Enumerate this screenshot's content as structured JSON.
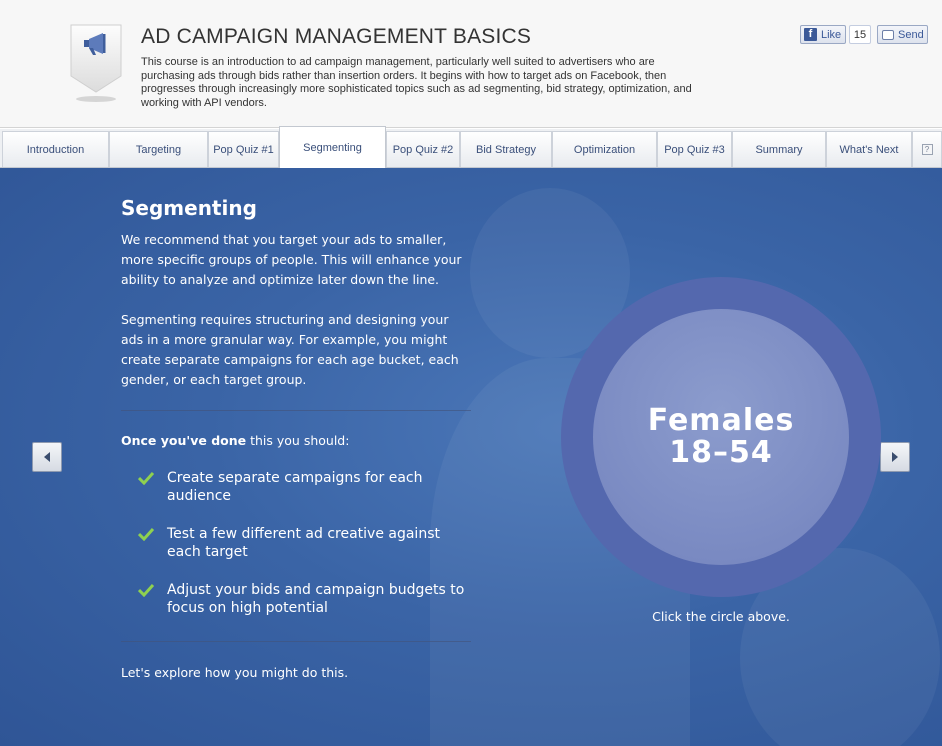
{
  "header": {
    "title": "AD CAMPAIGN MANAGEMENT BASICS",
    "description": "This course is an introduction to ad campaign management, particularly well suited to advertisers who are purchasing ads through bids rather than insertion orders. It begins with how to target ads on Facebook, then progresses through increasingly more sophisticated topics such as ad segmenting, bid strategy, optimization, and working with API vendors.",
    "badge_icon": "megaphone-icon",
    "like_label": "Like",
    "like_count": "15",
    "send_label": "Send"
  },
  "tabs": [
    {
      "label": "Introduction"
    },
    {
      "label": "Targeting"
    },
    {
      "label": "Pop Quiz #1"
    },
    {
      "label": "Segmenting",
      "active": true
    },
    {
      "label": "Pop Quiz #2"
    },
    {
      "label": "Bid Strategy"
    },
    {
      "label": "Optimization"
    },
    {
      "label": "Pop Quiz #3"
    },
    {
      "label": "Summary"
    },
    {
      "label": "What's Next"
    }
  ],
  "main": {
    "title": "Segmenting",
    "para1": "We recommend that you target your ads to smaller, more specific groups of people. This will enhance your ability to analyze and optimize later down the line.",
    "para2": "Segmenting requires structuring and designing your ads in a more granular way. For example, you might create separate campaigns for each age bucket, each gender, or each target group.",
    "once_bold": "Once you've done",
    "once_rest": " this you should:",
    "checklist": [
      "Create separate campaigns for each audience",
      "Test a few different ad creative against each target",
      "Adjust your bids and campaign budgets to focus on high potential"
    ],
    "explore": "Let's explore how you might do this.",
    "circle_line1": "Females",
    "circle_line2": "18–54",
    "circle_caption": "Click the circle above."
  },
  "colors": {
    "background": "#3a64a6",
    "circle_outer": "#5468ae",
    "circle_inner": "#8c9ccd",
    "check": "#8fd14f",
    "tab_text": "#3a4f7a"
  }
}
